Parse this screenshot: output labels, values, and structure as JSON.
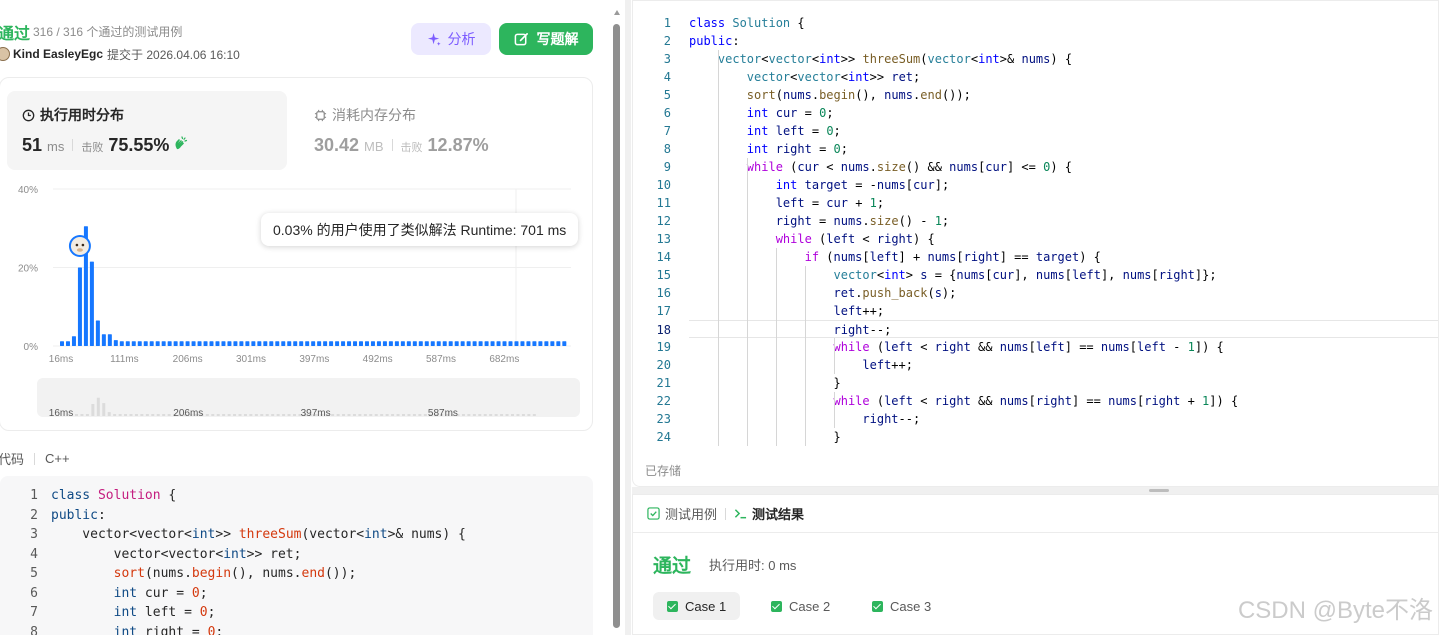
{
  "submission": {
    "status": "通过",
    "tests": "316 / 316 个通过的测试用例",
    "author": "Kind EasleyEgc",
    "submitted_at": "提交于 2026.04.06 16:10",
    "analyze_label": "分析",
    "write_label": "写题解"
  },
  "runtime": {
    "title": "执行用时分布",
    "value": "51",
    "unit": "ms",
    "beat_label": "击败",
    "beat": "75.55%"
  },
  "memory": {
    "title": "消耗内存分布",
    "value": "30.42",
    "unit": "MB",
    "beat_label": "击败",
    "beat": "12.87%"
  },
  "chart_data": {
    "type": "bar",
    "ytick_labels": [
      "40%",
      "20%",
      "0%"
    ],
    "ylim": [
      0,
      40
    ],
    "x_labels": [
      "16ms",
      "111ms",
      "206ms",
      "301ms",
      "397ms",
      "492ms",
      "587ms",
      "682ms"
    ],
    "values": [
      1.2,
      1.2,
      2.5,
      20,
      30.5,
      21.5,
      6.5,
      3,
      3,
      1.5,
      1.2,
      1.2,
      1.2,
      1.2,
      1.2,
      1.2,
      1.2,
      1.2,
      1.2,
      1.2,
      1.2,
      1.2,
      1.2,
      1.2,
      1.2,
      1.2,
      1.2,
      1.2,
      1.2,
      1.2,
      1.2,
      1.2,
      1.2,
      1.2,
      1.2,
      1.2,
      1.2,
      1.2,
      1.2,
      1.2,
      1.2,
      1.2,
      1.2,
      1.2,
      1.2,
      1.2,
      1.2,
      1.2,
      1.2,
      1.2,
      1.2,
      1.2,
      1.2,
      1.2,
      1.2,
      1.2,
      1.2,
      1.2,
      1.2,
      1.2,
      1.2,
      1.2,
      1.2,
      1.2,
      1.2,
      1.2,
      1.2,
      1.2,
      1.2,
      1.2,
      1.2,
      1.2,
      1.2,
      1.2,
      1.2,
      1.2,
      1.2,
      1.2,
      1.2,
      1.2,
      1.2,
      1.2,
      1.2,
      1.2,
      1.2
    ],
    "highlight_index": 4,
    "grid": true,
    "overview_labels": [
      "16ms",
      "206ms",
      "397ms",
      "587ms"
    ]
  },
  "tooltip": {
    "text": "0.03% 的用户使用了类似解法 Runtime: 701 ms"
  },
  "code_head": {
    "label": "代码",
    "lang": "C++"
  },
  "code_preview": [
    {
      "n": "1",
      "segs": [
        [
          "cb-kw",
          "class "
        ],
        [
          "cb-cls",
          "Solution"
        ],
        [
          "",
          " {"
        ]
      ]
    },
    {
      "n": "2",
      "segs": [
        [
          "cb-kw",
          "public"
        ],
        [
          "",
          ":"
        ]
      ]
    },
    {
      "n": "3",
      "segs": [
        [
          "",
          "    vector<vector<"
        ],
        [
          "cb-ty",
          "int"
        ],
        [
          "",
          ">> "
        ],
        [
          "cb-fn",
          "threeSum"
        ],
        [
          "",
          "(vector<"
        ],
        [
          "cb-ty",
          "int"
        ],
        [
          "",
          ">& nums) {"
        ]
      ]
    },
    {
      "n": "4",
      "segs": [
        [
          "",
          "        vector<vector<"
        ],
        [
          "cb-ty",
          "int"
        ],
        [
          "",
          ">> ret;"
        ]
      ]
    },
    {
      "n": "5",
      "segs": [
        [
          "",
          "        "
        ],
        [
          "cb-fn",
          "sort"
        ],
        [
          "",
          "(nums."
        ],
        [
          "cb-fn",
          "begin"
        ],
        [
          "",
          "(), nums."
        ],
        [
          "cb-fn",
          "end"
        ],
        [
          "",
          "());"
        ]
      ]
    },
    {
      "n": "6",
      "segs": [
        [
          "",
          "        "
        ],
        [
          "cb-ty",
          "int"
        ],
        [
          "",
          " cur = "
        ],
        [
          "cb-nm",
          "0"
        ],
        [
          "",
          ";"
        ]
      ]
    },
    {
      "n": "7",
      "segs": [
        [
          "",
          "        "
        ],
        [
          "cb-ty",
          "int"
        ],
        [
          "",
          " left = "
        ],
        [
          "cb-nm",
          "0"
        ],
        [
          "",
          ";"
        ]
      ]
    },
    {
      "n": "8",
      "segs": [
        [
          "",
          "        "
        ],
        [
          "cb-ty",
          "int"
        ],
        [
          "",
          " right = "
        ],
        [
          "cb-nm",
          "0"
        ],
        [
          "",
          ";"
        ]
      ]
    }
  ],
  "editor": {
    "saved_label": "已存储",
    "active_line": 18,
    "lines": [
      [
        [
          "kw",
          "class "
        ],
        [
          "ty",
          "Solution"
        ],
        [
          "",
          " {"
        ]
      ],
      [
        [
          "kw",
          "public"
        ],
        [
          "",
          ":"
        ]
      ],
      [
        [
          "",
          "    "
        ],
        [
          "ty",
          "vector"
        ],
        [
          "",
          "<"
        ],
        [
          "ty",
          "vector"
        ],
        [
          "",
          "<"
        ],
        [
          "kw",
          "int"
        ],
        [
          "",
          ">> "
        ],
        [
          "fn",
          "threeSum"
        ],
        [
          "",
          "("
        ],
        [
          "ty",
          "vector"
        ],
        [
          "",
          "<"
        ],
        [
          "kw",
          "int"
        ],
        [
          "",
          ">& "
        ],
        [
          "vr",
          "nums"
        ],
        [
          "",
          ") {"
        ]
      ],
      [
        [
          "",
          "        "
        ],
        [
          "ty",
          "vector"
        ],
        [
          "",
          "<"
        ],
        [
          "ty",
          "vector"
        ],
        [
          "",
          "<"
        ],
        [
          "kw",
          "int"
        ],
        [
          "",
          ">> "
        ],
        [
          "vr",
          "ret"
        ],
        [
          "",
          ";"
        ]
      ],
      [
        [
          "",
          "        "
        ],
        [
          "fn",
          "sort"
        ],
        [
          "",
          "("
        ],
        [
          "vr",
          "nums"
        ],
        [
          "",
          "."
        ],
        [
          "fn",
          "begin"
        ],
        [
          "",
          "(), "
        ],
        [
          "vr",
          "nums"
        ],
        [
          "",
          "."
        ],
        [
          "fn",
          "end"
        ],
        [
          "",
          "());"
        ]
      ],
      [
        [
          "",
          "        "
        ],
        [
          "kw",
          "int"
        ],
        [
          "",
          " "
        ],
        [
          "vr",
          "cur"
        ],
        [
          "",
          " = "
        ],
        [
          "nm",
          "0"
        ],
        [
          "",
          ";"
        ]
      ],
      [
        [
          "",
          "        "
        ],
        [
          "kw",
          "int"
        ],
        [
          "",
          " "
        ],
        [
          "vr",
          "left"
        ],
        [
          "",
          " = "
        ],
        [
          "nm",
          "0"
        ],
        [
          "",
          ";"
        ]
      ],
      [
        [
          "",
          "        "
        ],
        [
          "kw",
          "int"
        ],
        [
          "",
          " "
        ],
        [
          "vr",
          "right"
        ],
        [
          "",
          " = "
        ],
        [
          "nm",
          "0"
        ],
        [
          "",
          ";"
        ]
      ],
      [
        [
          "",
          "        "
        ],
        [
          "cf",
          "while"
        ],
        [
          "",
          " ("
        ],
        [
          "vr",
          "cur"
        ],
        [
          "",
          " < "
        ],
        [
          "vr",
          "nums"
        ],
        [
          "",
          "."
        ],
        [
          "fn",
          "size"
        ],
        [
          "",
          "() && "
        ],
        [
          "vr",
          "nums"
        ],
        [
          "",
          "["
        ],
        [
          "vr",
          "cur"
        ],
        [
          "",
          "] <= "
        ],
        [
          "nm",
          "0"
        ],
        [
          "",
          ") {"
        ]
      ],
      [
        [
          "",
          "            "
        ],
        [
          "kw",
          "int"
        ],
        [
          "",
          " "
        ],
        [
          "vr",
          "target"
        ],
        [
          "",
          " = -"
        ],
        [
          "vr",
          "nums"
        ],
        [
          "",
          "["
        ],
        [
          "vr",
          "cur"
        ],
        [
          "",
          "];"
        ]
      ],
      [
        [
          "",
          "            "
        ],
        [
          "vr",
          "left"
        ],
        [
          "",
          " = "
        ],
        [
          "vr",
          "cur"
        ],
        [
          "",
          " + "
        ],
        [
          "nm",
          "1"
        ],
        [
          "",
          ";"
        ]
      ],
      [
        [
          "",
          "            "
        ],
        [
          "vr",
          "right"
        ],
        [
          "",
          " = "
        ],
        [
          "vr",
          "nums"
        ],
        [
          "",
          "."
        ],
        [
          "fn",
          "size"
        ],
        [
          "",
          "() - "
        ],
        [
          "nm",
          "1"
        ],
        [
          "",
          ";"
        ]
      ],
      [
        [
          "",
          "            "
        ],
        [
          "cf",
          "while"
        ],
        [
          "",
          " ("
        ],
        [
          "vr",
          "left"
        ],
        [
          "",
          " < "
        ],
        [
          "vr",
          "right"
        ],
        [
          "",
          ") {"
        ]
      ],
      [
        [
          "",
          "                "
        ],
        [
          "cf",
          "if"
        ],
        [
          "",
          " ("
        ],
        [
          "vr",
          "nums"
        ],
        [
          "",
          "["
        ],
        [
          "vr",
          "left"
        ],
        [
          "",
          "] + "
        ],
        [
          "vr",
          "nums"
        ],
        [
          "",
          "["
        ],
        [
          "vr",
          "right"
        ],
        [
          "",
          "] == "
        ],
        [
          "vr",
          "target"
        ],
        [
          "",
          ") {"
        ]
      ],
      [
        [
          "",
          "                    "
        ],
        [
          "ty",
          "vector"
        ],
        [
          "",
          "<"
        ],
        [
          "kw",
          "int"
        ],
        [
          "",
          "> "
        ],
        [
          "vr",
          "s"
        ],
        [
          "",
          " = {"
        ],
        [
          "vr",
          "nums"
        ],
        [
          "",
          "["
        ],
        [
          "vr",
          "cur"
        ],
        [
          "",
          "], "
        ],
        [
          "vr",
          "nums"
        ],
        [
          "",
          "["
        ],
        [
          "vr",
          "left"
        ],
        [
          "",
          "], "
        ],
        [
          "vr",
          "nums"
        ],
        [
          "",
          "["
        ],
        [
          "vr",
          "right"
        ],
        [
          "",
          "]};"
        ]
      ],
      [
        [
          "",
          "                    "
        ],
        [
          "vr",
          "ret"
        ],
        [
          "",
          "."
        ],
        [
          "fn",
          "push_back"
        ],
        [
          "",
          "("
        ],
        [
          "vr",
          "s"
        ],
        [
          "",
          ");"
        ]
      ],
      [
        [
          "",
          "                    "
        ],
        [
          "vr",
          "left"
        ],
        [
          "",
          "++;"
        ]
      ],
      [
        [
          "",
          "                    "
        ],
        [
          "vr",
          "right"
        ],
        [
          "",
          "--;"
        ]
      ],
      [
        [
          "",
          "                    "
        ],
        [
          "cf",
          "while"
        ],
        [
          "",
          " ("
        ],
        [
          "vr",
          "left"
        ],
        [
          "",
          " < "
        ],
        [
          "vr",
          "right"
        ],
        [
          "",
          " && "
        ],
        [
          "vr",
          "nums"
        ],
        [
          "",
          "["
        ],
        [
          "vr",
          "left"
        ],
        [
          "",
          "] == "
        ],
        [
          "vr",
          "nums"
        ],
        [
          "",
          "["
        ],
        [
          "vr",
          "left"
        ],
        [
          "",
          " - "
        ],
        [
          "nm",
          "1"
        ],
        [
          "",
          "]) {"
        ]
      ],
      [
        [
          "",
          "                        "
        ],
        [
          "vr",
          "left"
        ],
        [
          "",
          "++;"
        ]
      ],
      [
        [
          "",
          "                    }"
        ]
      ],
      [
        [
          "",
          "                    "
        ],
        [
          "cf",
          "while"
        ],
        [
          "",
          " ("
        ],
        [
          "vr",
          "left"
        ],
        [
          "",
          " < "
        ],
        [
          "vr",
          "right"
        ],
        [
          "",
          " && "
        ],
        [
          "vr",
          "nums"
        ],
        [
          "",
          "["
        ],
        [
          "vr",
          "right"
        ],
        [
          "",
          "] == "
        ],
        [
          "vr",
          "nums"
        ],
        [
          "",
          "["
        ],
        [
          "vr",
          "right"
        ],
        [
          "",
          " + "
        ],
        [
          "nm",
          "1"
        ],
        [
          "",
          "]) {"
        ]
      ],
      [
        [
          "",
          "                        "
        ],
        [
          "vr",
          "right"
        ],
        [
          "",
          "--;"
        ]
      ],
      [
        [
          "",
          "                    }"
        ]
      ]
    ]
  },
  "result": {
    "tab_testcase": "测试用例",
    "tab_result": "测试结果",
    "status": "通过",
    "time": "执行用时: 0 ms",
    "cases": [
      "Case 1",
      "Case 2",
      "Case 3"
    ]
  },
  "watermark": "CSDN @Byte不洛",
  "colors": {
    "accent_green": "#2db55d",
    "analyze_purple": "#7c5cff",
    "bar_blue": "#1677ff"
  }
}
